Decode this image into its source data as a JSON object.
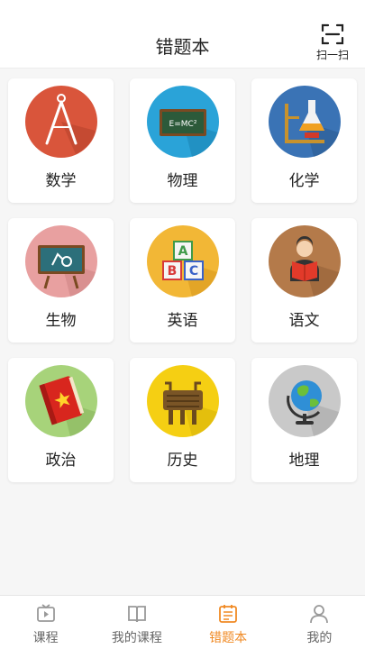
{
  "header": {
    "title": "错题本",
    "scan_label": "扫一扫"
  },
  "subjects": [
    {
      "label": "数学",
      "icon": "compass-icon"
    },
    {
      "label": "物理",
      "icon": "chalkboard-icon"
    },
    {
      "label": "化学",
      "icon": "flask-icon"
    },
    {
      "label": "生物",
      "icon": "microscope-board-icon"
    },
    {
      "label": "英语",
      "icon": "abc-blocks-icon"
    },
    {
      "label": "语文",
      "icon": "reading-person-icon"
    },
    {
      "label": "政治",
      "icon": "red-book-icon"
    },
    {
      "label": "历史",
      "icon": "bronze-ding-icon"
    },
    {
      "label": "地理",
      "icon": "globe-icon"
    }
  ],
  "tabs": [
    {
      "label": "课程",
      "icon": "video-play-icon",
      "active": false
    },
    {
      "label": "我的课程",
      "icon": "open-book-icon",
      "active": false
    },
    {
      "label": "错题本",
      "icon": "notebook-icon",
      "active": true
    },
    {
      "label": "我的",
      "icon": "person-icon",
      "active": false
    }
  ],
  "colors": {
    "accent": "#f08a24",
    "math": "#d9553b",
    "physics": "#2aa3d8",
    "chemistry": "#3a73b5",
    "biology": "#e8a0a0",
    "english": "#f2b736",
    "chinese": "#b47a4a",
    "politics": "#a7d37a",
    "history": "#f5cf13",
    "geography": "#c9c9c9"
  }
}
